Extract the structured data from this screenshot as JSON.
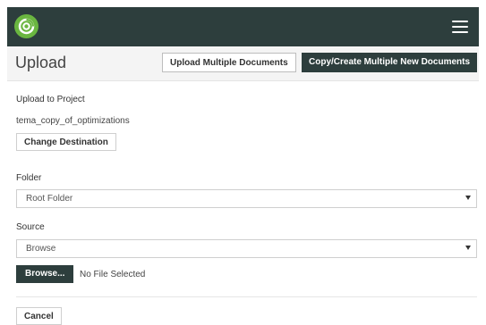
{
  "header": {
    "menu_icon": "hamburger-icon",
    "logo_icon": "app-logo-icon"
  },
  "page": {
    "title": "Upload",
    "upload_multiple_label": "Upload Multiple Documents",
    "copy_create_label": "Copy/Create Multiple New Documents"
  },
  "form": {
    "upload_to_project_label": "Upload to Project",
    "project_name": "tema_copy_of_optimizations",
    "change_destination_label": "Change Destination",
    "folder_label": "Folder",
    "folder_value": "Root Folder",
    "source_label": "Source",
    "source_value": "Browse",
    "browse_button_label": "Browse...",
    "file_status": "No File Selected",
    "cancel_label": "Cancel"
  },
  "colors": {
    "topbar": "#2d3e3d",
    "logo": "#6ab640",
    "dark_button": "#2d3e3d"
  }
}
